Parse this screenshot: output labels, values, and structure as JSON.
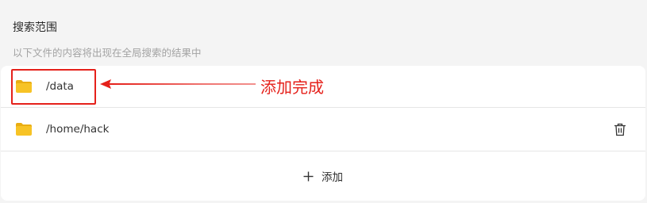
{
  "section": {
    "title": "搜索范围",
    "description": "以下文件的内容将出现在全局搜索的结果中"
  },
  "paths": [
    {
      "path": "/data",
      "icon": "folder-icon"
    },
    {
      "path": "/home/hack",
      "icon": "folder-icon",
      "delete_icon": "trash-icon"
    }
  ],
  "add_button": {
    "label": "添加",
    "icon": "plus-icon"
  },
  "annotation": {
    "text": "添加完成",
    "color": "#e5211b"
  },
  "colors": {
    "folder": "#f7c325",
    "folder_tab": "#e9ad12",
    "accent_annotation": "#e5211b"
  }
}
